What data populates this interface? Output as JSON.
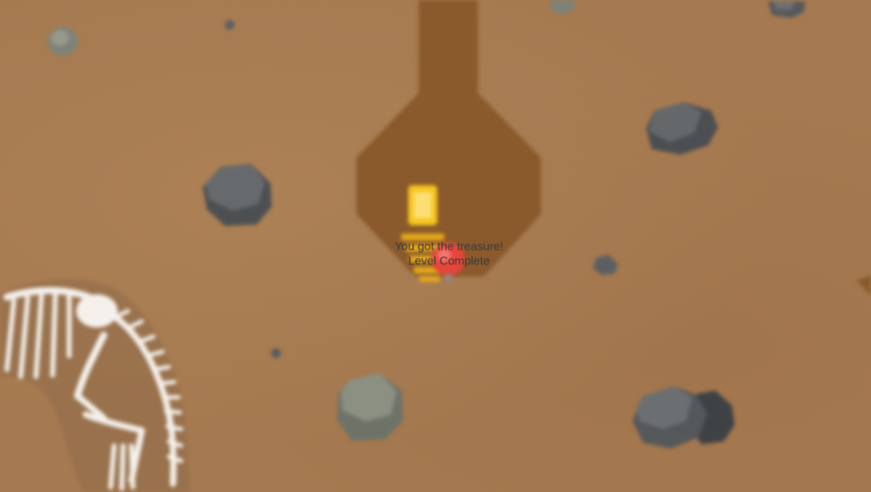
{
  "game": {
    "message": {
      "line1": "You got the treasure!",
      "line2": "Level Complete"
    },
    "state": "level-complete",
    "objects": {
      "treasure": "gold-bar-icon",
      "player": "digger-icon",
      "fossil": "dinosaur-skeleton-icon",
      "rocks": [
        "rock-icon",
        "rock-icon",
        "rock-icon",
        "rock-icon",
        "rock-icon",
        "rock-icon",
        "rock-icon",
        "rock-icon",
        "rock-icon",
        "rock-icon",
        "rock-icon",
        "rock-icon"
      ]
    },
    "colors": {
      "dirt": "#a67a50",
      "tunnel": "#8a5a2c",
      "rock": "#6b6d6e",
      "gold": "#f2c21b",
      "digger": "#e8443a",
      "bone": "#f4f1ec"
    }
  }
}
